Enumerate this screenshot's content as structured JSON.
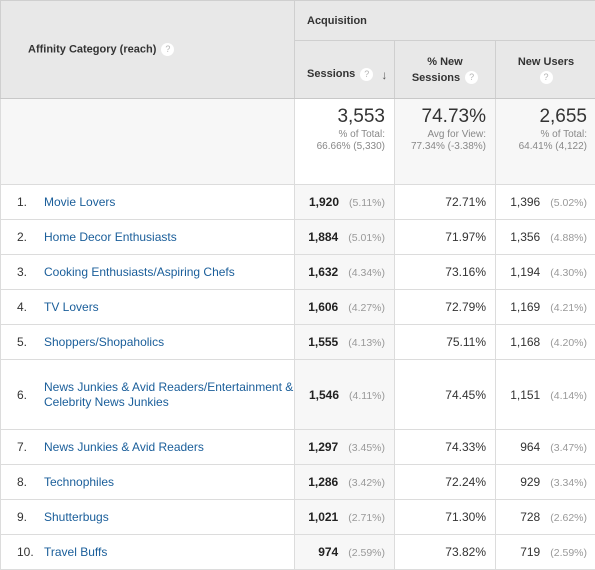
{
  "header": {
    "dimension_label": "Affinity Category (reach)",
    "group_label": "Acquisition",
    "columns": {
      "sessions": "Sessions",
      "new_sessions_line1": "% New",
      "new_sessions_line2": "Sessions",
      "new_users": "New Users"
    },
    "help_glyph": "?",
    "sort_glyph": "↓"
  },
  "totals": {
    "sessions": {
      "value": "3,553",
      "sub1": "% of Total:",
      "sub2": "66.66% (5,330)"
    },
    "new_sessions": {
      "value": "74.73%",
      "sub1": "Avg for View:",
      "sub2": "77.34% (-3.38%)"
    },
    "new_users": {
      "value": "2,655",
      "sub1": "% of Total:",
      "sub2": "64.41% (4,122)"
    }
  },
  "rows": [
    {
      "index": "1.",
      "category": "Movie Lovers",
      "sessions": "1,920",
      "sessions_pct": "(5.11%)",
      "new_sessions": "72.71%",
      "new_users": "1,396",
      "new_users_pct": "(5.02%)"
    },
    {
      "index": "2.",
      "category": "Home Decor Enthusiasts",
      "sessions": "1,884",
      "sessions_pct": "(5.01%)",
      "new_sessions": "71.97%",
      "new_users": "1,356",
      "new_users_pct": "(4.88%)"
    },
    {
      "index": "3.",
      "category": "Cooking Enthusiasts/Aspiring Chefs",
      "sessions": "1,632",
      "sessions_pct": "(4.34%)",
      "new_sessions": "73.16%",
      "new_users": "1,194",
      "new_users_pct": "(4.30%)"
    },
    {
      "index": "4.",
      "category": "TV Lovers",
      "sessions": "1,606",
      "sessions_pct": "(4.27%)",
      "new_sessions": "72.79%",
      "new_users": "1,169",
      "new_users_pct": "(4.21%)"
    },
    {
      "index": "5.",
      "category": "Shoppers/Shopaholics",
      "sessions": "1,555",
      "sessions_pct": "(4.13%)",
      "new_sessions": "75.11%",
      "new_users": "1,168",
      "new_users_pct": "(4.20%)"
    },
    {
      "index": "6.",
      "category": "News Junkies & Avid Readers/Entertainment & Celebrity News Junkies",
      "sessions": "1,546",
      "sessions_pct": "(4.11%)",
      "new_sessions": "74.45%",
      "new_users": "1,151",
      "new_users_pct": "(4.14%)"
    },
    {
      "index": "7.",
      "category": "News Junkies & Avid Readers",
      "sessions": "1,297",
      "sessions_pct": "(3.45%)",
      "new_sessions": "74.33%",
      "new_users": "964",
      "new_users_pct": "(3.47%)"
    },
    {
      "index": "8.",
      "category": "Technophiles",
      "sessions": "1,286",
      "sessions_pct": "(3.42%)",
      "new_sessions": "72.24%",
      "new_users": "929",
      "new_users_pct": "(3.34%)"
    },
    {
      "index": "9.",
      "category": "Shutterbugs",
      "sessions": "1,021",
      "sessions_pct": "(2.71%)",
      "new_sessions": "71.30%",
      "new_users": "728",
      "new_users_pct": "(2.62%)"
    },
    {
      "index": "10.",
      "category": "Travel Buffs",
      "sessions": "974",
      "sessions_pct": "(2.59%)",
      "new_sessions": "73.82%",
      "new_users": "719",
      "new_users_pct": "(2.59%)"
    }
  ]
}
